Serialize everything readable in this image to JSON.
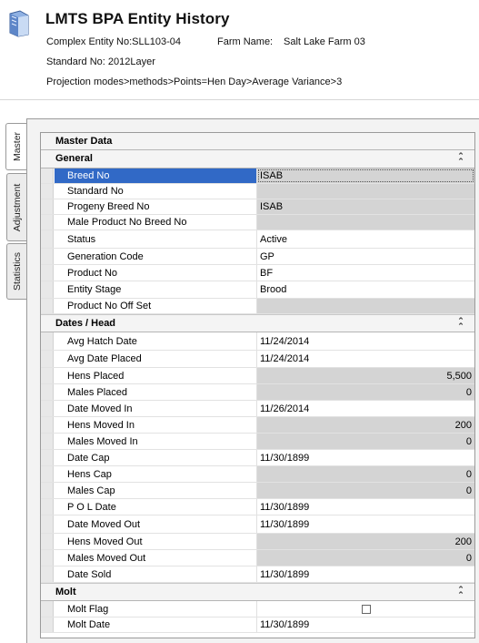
{
  "header": {
    "title": "LMTS BPA Entity History",
    "complex_entity": "Complex Entity No:SLL103-04",
    "farm_label": "Farm Name:",
    "farm_value": "Salt Lake Farm 03",
    "standard": "Standard No: 2012Layer",
    "projection": "Projection modes>methods>Points=Hen Day>Average Variance>3"
  },
  "tabs": [
    {
      "label": "Master",
      "active": true
    },
    {
      "label": "Adjustment",
      "active": false
    },
    {
      "label": "Statistics",
      "active": false
    }
  ],
  "grid": {
    "title": "Master Data",
    "sections": [
      {
        "title": "General",
        "rows": [
          {
            "label": "Breed No",
            "value": "ISAB",
            "selected": true
          },
          {
            "label": "Standard No",
            "value": ""
          },
          {
            "label": "Progeny Breed No",
            "value": "ISAB"
          },
          {
            "label": "Male Product No Breed No",
            "value": ""
          },
          {
            "label": "Status",
            "value": "Active"
          },
          {
            "label": "Generation Code",
            "value": "GP"
          },
          {
            "label": "Product No",
            "value": "BF"
          },
          {
            "label": "Entity Stage",
            "value": "Brood"
          },
          {
            "label": "Product No Off Set",
            "value": ""
          }
        ]
      },
      {
        "title": "Dates / Head",
        "rows": [
          {
            "label": "Avg Hatch Date",
            "value": "11/24/2014"
          },
          {
            "label": "Avg Date Placed",
            "value": "11/24/2014"
          },
          {
            "label": "Hens Placed",
            "value": "5,500"
          },
          {
            "label": "Males Placed",
            "value": "0"
          },
          {
            "label": "Date Moved In",
            "value": "11/26/2014"
          },
          {
            "label": "Hens Moved In",
            "value": "200"
          },
          {
            "label": "Males Moved In",
            "value": "0"
          },
          {
            "label": "Date Cap",
            "value": "11/30/1899"
          },
          {
            "label": "Hens Cap",
            "value": "0"
          },
          {
            "label": "Males Cap",
            "value": "0"
          },
          {
            "label": "P O L Date",
            "value": "11/30/1899"
          },
          {
            "label": "Date Moved Out",
            "value": "11/30/1899"
          },
          {
            "label": "Hens Moved Out",
            "value": "200"
          },
          {
            "label": "Males Moved Out",
            "value": "0"
          },
          {
            "label": "Date Sold",
            "value": "11/30/1899"
          }
        ]
      },
      {
        "title": "Molt",
        "rows": [
          {
            "label": "Molt Flag",
            "value": "",
            "checked": false
          },
          {
            "label": "Molt Date",
            "value": "11/30/1899"
          }
        ]
      }
    ]
  }
}
